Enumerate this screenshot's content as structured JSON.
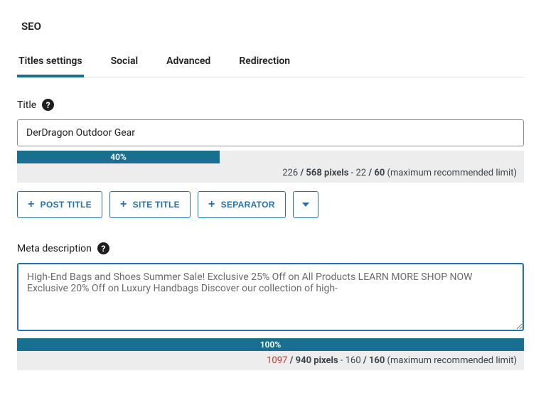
{
  "page_title": "SEO",
  "tabs": [
    {
      "label": "Titles settings",
      "active": true
    },
    {
      "label": "Social",
      "active": false
    },
    {
      "label": "Advanced",
      "active": false
    },
    {
      "label": "Redirection",
      "active": false
    }
  ],
  "title_section": {
    "label": "Title",
    "value": "DerDragon Outdoor Gear",
    "progress_pct": "40%",
    "progress_width": 40,
    "stats": {
      "px_used": "226",
      "px_limit": "568 pixels",
      "chars_used": "22",
      "chars_limit": "60",
      "suffix": "(maximum recommended limit)"
    },
    "tokens": [
      "POST TITLE",
      "SITE TITLE",
      "SEPARATOR"
    ]
  },
  "meta_section": {
    "label": "Meta description",
    "value": "High-End Bags and Shoes Summer Sale! Exclusive 25% Off on All Products LEARN MORE SHOP NOW Exclusive 20% Off on Luxury Handbags Discover our collection of high-",
    "progress_pct": "100%",
    "progress_width": 100,
    "stats": {
      "px_used": "1097",
      "px_used_warn": true,
      "px_limit": "940 pixels",
      "chars_used": "160",
      "chars_limit": "160",
      "suffix": "(maximum recommended limit)"
    }
  }
}
